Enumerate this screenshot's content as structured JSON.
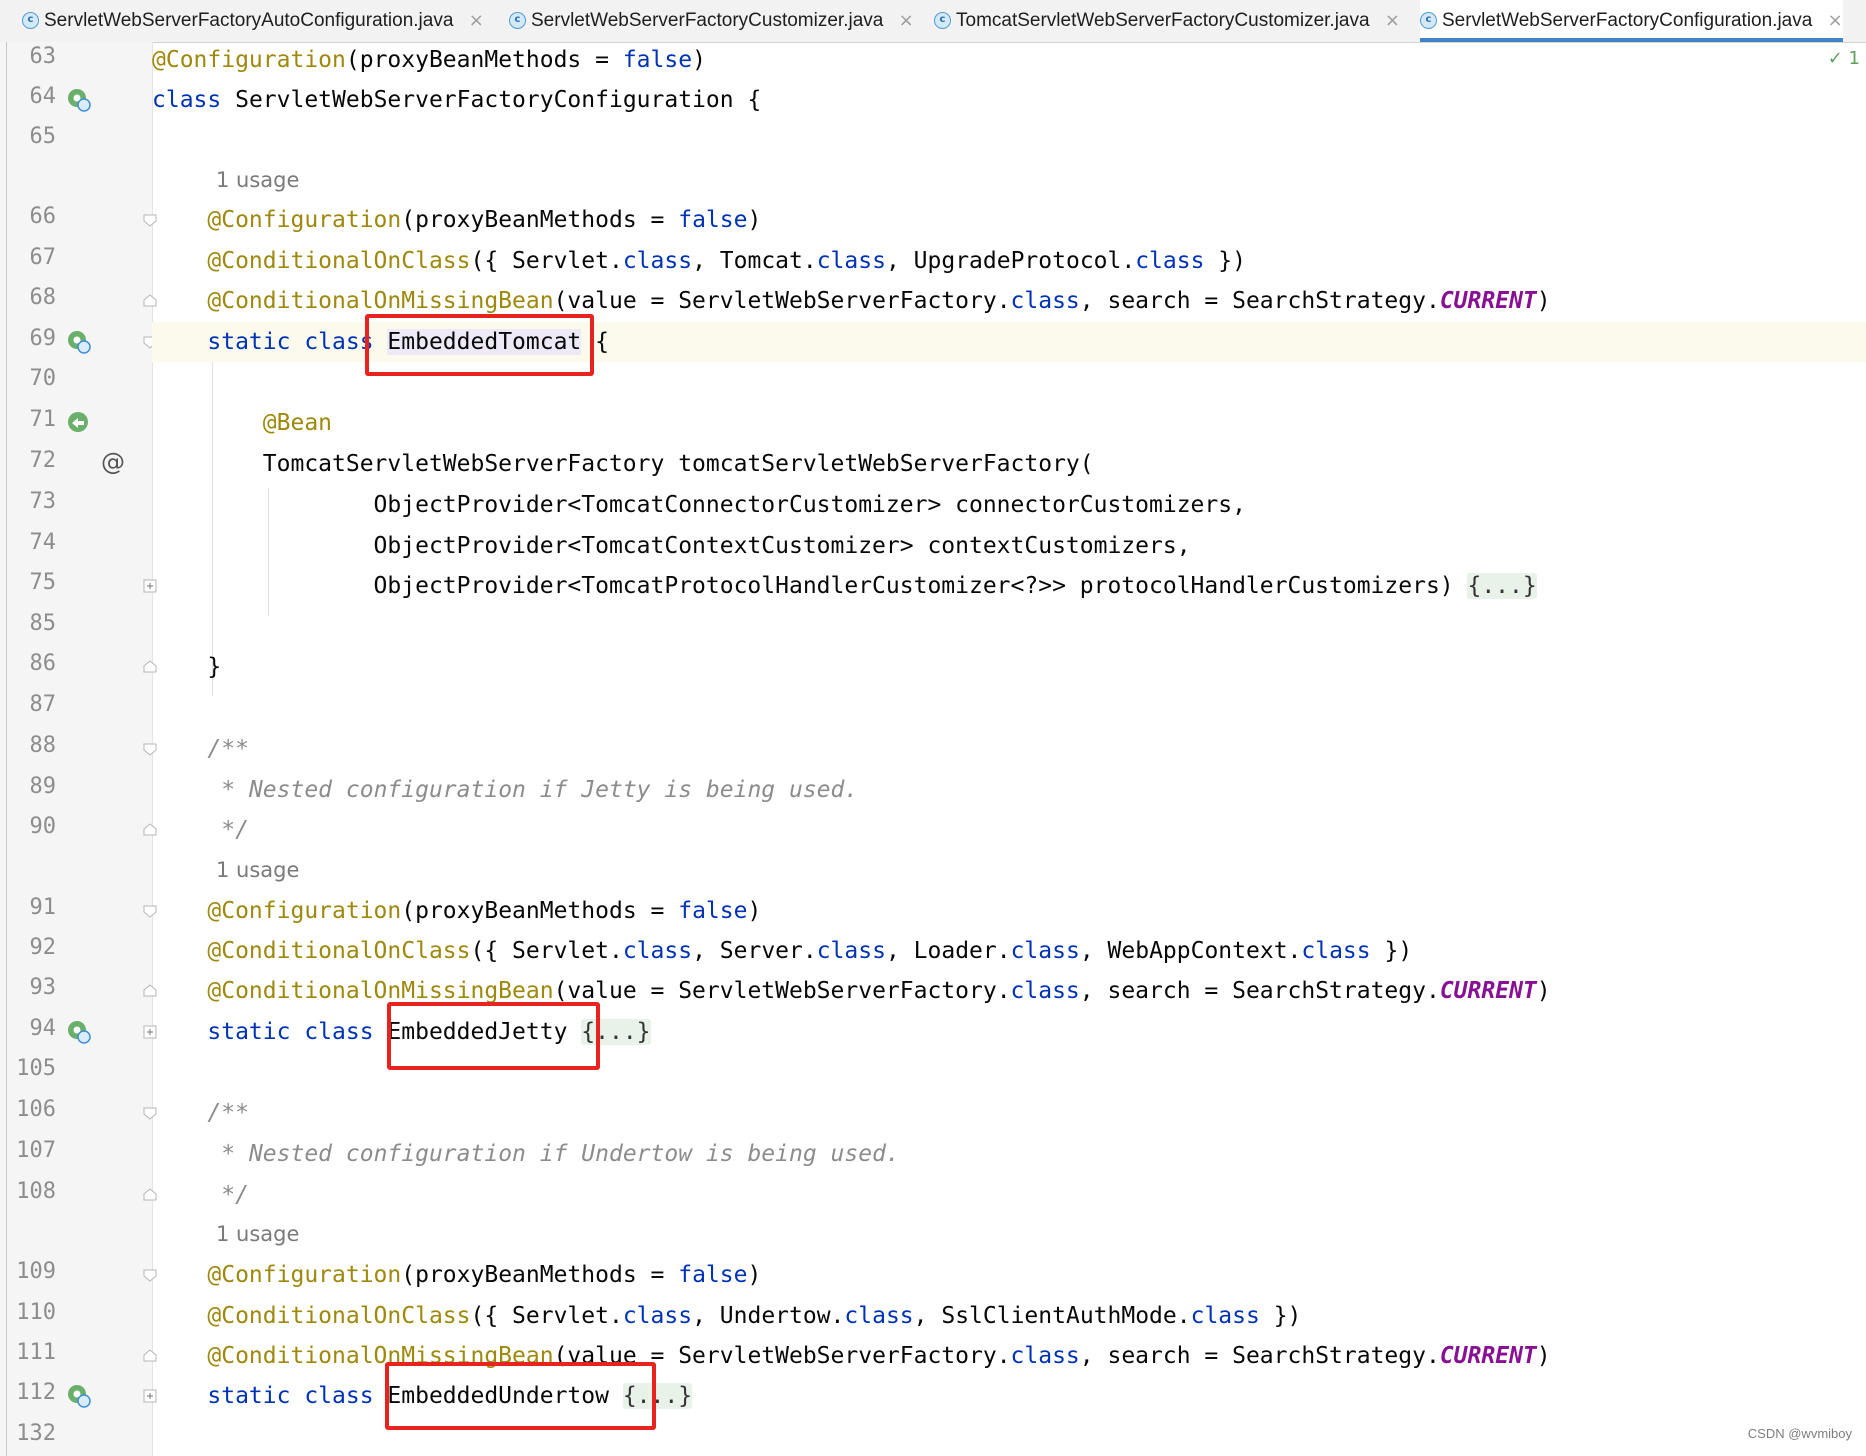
{
  "tabs": [
    {
      "label": "ServletWebServerFactoryAutoConfiguration.java",
      "icon": "c",
      "close": "×",
      "active": false
    },
    {
      "label": "ServletWebServerFactoryCustomizer.java",
      "icon": "c",
      "close": "×",
      "active": false
    },
    {
      "label": "TomcatServletWebServerFactoryCustomizer.java",
      "icon": "c",
      "close": "×",
      "active": false
    },
    {
      "label": "ServletWebServerFactoryConfiguration.java",
      "icon": "c",
      "close": "×",
      "active": true
    }
  ],
  "right_status": "✓ 1",
  "watermark": "CSDN @wvmiboy",
  "usage_label": "1 usage",
  "gutter": {
    "line_numbers": [
      "63",
      "64",
      "65",
      "66",
      "67",
      "68",
      "69",
      "70",
      "71",
      "72",
      "73",
      "74",
      "75",
      "85",
      "86",
      "87",
      "88",
      "89",
      "90",
      "91",
      "92",
      "93",
      "94",
      "105",
      "106",
      "107",
      "108",
      "109",
      "110",
      "111",
      "112",
      "132"
    ],
    "icons": [
      "bean-gear-icon",
      "override-bean-icon",
      "at-icon",
      "fold-icon",
      "unfold-icon"
    ]
  },
  "code": {
    "lines": [
      [
        [
          "ann",
          "@Configuration"
        ],
        [
          "",
          "(proxyBeanMethods = "
        ],
        [
          "kw",
          "false"
        ],
        [
          "",
          ")"
        ]
      ],
      [
        [
          "kw",
          "class"
        ],
        [
          "",
          " ServletWebServerFactoryConfiguration {"
        ]
      ],
      [],
      [
        [
          "",
          "    "
        ],
        [
          "ann",
          "@Configuration"
        ],
        [
          "",
          "(proxyBeanMethods = "
        ],
        [
          "kw",
          "false"
        ],
        [
          "",
          ")"
        ]
      ],
      [
        [
          "",
          "    "
        ],
        [
          "ann",
          "@ConditionalOnClass"
        ],
        [
          "",
          "({ Servlet."
        ],
        [
          "kw",
          "class"
        ],
        [
          "",
          ", Tomcat."
        ],
        [
          "kw",
          "class"
        ],
        [
          "",
          ", UpgradeProtocol."
        ],
        [
          "kw",
          "class"
        ],
        [
          "",
          " })"
        ]
      ],
      [
        [
          "",
          "    "
        ],
        [
          "ann",
          "@ConditionalOnMissingBean"
        ],
        [
          "",
          "(value = ServletWebServerFactory."
        ],
        [
          "kw",
          "class"
        ],
        [
          "",
          ", search = SearchStrategy."
        ],
        [
          "st",
          "CURRENT"
        ],
        [
          "",
          ")"
        ]
      ],
      [
        [
          "",
          "    "
        ],
        [
          "kw",
          "static class"
        ],
        [
          "",
          " "
        ],
        [
          "hl",
          "EmbeddedTomcat"
        ],
        [
          "",
          " {"
        ]
      ],
      [],
      [
        [
          "",
          "        "
        ],
        [
          "ann",
          "@Bean"
        ]
      ],
      [
        [
          "",
          "        TomcatServletWebServerFactory tomcatServletWebServerFactory("
        ]
      ],
      [
        [
          "",
          "                ObjectProvider<TomcatConnectorCustomizer> connectorCustomizers,"
        ]
      ],
      [
        [
          "",
          "                ObjectProvider<TomcatContextCustomizer> contextCustomizers,"
        ]
      ],
      [
        [
          "",
          "                ObjectProvider<TomcatProtocolHandlerCustomizer<?>> protocolHandlerCustomizers) "
        ],
        [
          "fd",
          "{...}"
        ]
      ],
      [],
      [
        [
          "",
          "    }"
        ]
      ],
      [],
      [
        [
          "",
          "    "
        ],
        [
          "cmt",
          "/**"
        ]
      ],
      [
        [
          "",
          "     "
        ],
        [
          "cmt",
          "* Nested configuration if Jetty is being used."
        ]
      ],
      [
        [
          "",
          "     "
        ],
        [
          "cmt",
          "*/"
        ]
      ],
      [
        [
          "",
          "    "
        ],
        [
          "ann",
          "@Configuration"
        ],
        [
          "",
          "(proxyBeanMethods = "
        ],
        [
          "kw",
          "false"
        ],
        [
          "",
          ")"
        ]
      ],
      [
        [
          "",
          "    "
        ],
        [
          "ann",
          "@ConditionalOnClass"
        ],
        [
          "",
          "({ Servlet."
        ],
        [
          "kw",
          "class"
        ],
        [
          "",
          ", Server."
        ],
        [
          "kw",
          "class"
        ],
        [
          "",
          ", Loader."
        ],
        [
          "kw",
          "class"
        ],
        [
          "",
          ", WebAppContext."
        ],
        [
          "kw",
          "class"
        ],
        [
          "",
          " })"
        ]
      ],
      [
        [
          "",
          "    "
        ],
        [
          "ann",
          "@ConditionalOnMissingBean"
        ],
        [
          "",
          "(value = ServletWebServerFactory."
        ],
        [
          "kw",
          "class"
        ],
        [
          "",
          ", search = SearchStrategy."
        ],
        [
          "st",
          "CURRENT"
        ],
        [
          "",
          ")"
        ]
      ],
      [
        [
          "",
          "    "
        ],
        [
          "kw",
          "static class"
        ],
        [
          "",
          " EmbeddedJetty "
        ],
        [
          "fd",
          "{...}"
        ]
      ],
      [],
      [
        [
          "",
          "    "
        ],
        [
          "cmt",
          "/**"
        ]
      ],
      [
        [
          "",
          "     "
        ],
        [
          "cmt",
          "* Nested configuration if Undertow is being used."
        ]
      ],
      [
        [
          "",
          "     "
        ],
        [
          "cmt",
          "*/"
        ]
      ],
      [
        [
          "",
          "    "
        ],
        [
          "ann",
          "@Configuration"
        ],
        [
          "",
          "(proxyBeanMethods = "
        ],
        [
          "kw",
          "false"
        ],
        [
          "",
          ")"
        ]
      ],
      [
        [
          "",
          "    "
        ],
        [
          "ann",
          "@ConditionalOnClass"
        ],
        [
          "",
          "({ Servlet."
        ],
        [
          "kw",
          "class"
        ],
        [
          "",
          ", Undertow."
        ],
        [
          "kw",
          "class"
        ],
        [
          "",
          ", SslClientAuthMode."
        ],
        [
          "kw",
          "class"
        ],
        [
          "",
          " })"
        ]
      ],
      [
        [
          "",
          "    "
        ],
        [
          "ann",
          "@ConditionalOnMissingBean"
        ],
        [
          "",
          "(value = ServletWebServerFactory."
        ],
        [
          "kw",
          "class"
        ],
        [
          "",
          ", search = SearchStrategy."
        ],
        [
          "st",
          "CURRENT"
        ],
        [
          "",
          ")"
        ]
      ],
      [
        [
          "",
          "    "
        ],
        [
          "kw",
          "static class"
        ],
        [
          "",
          " EmbeddedUndertow "
        ],
        [
          "fd",
          "{...}"
        ]
      ],
      []
    ]
  }
}
